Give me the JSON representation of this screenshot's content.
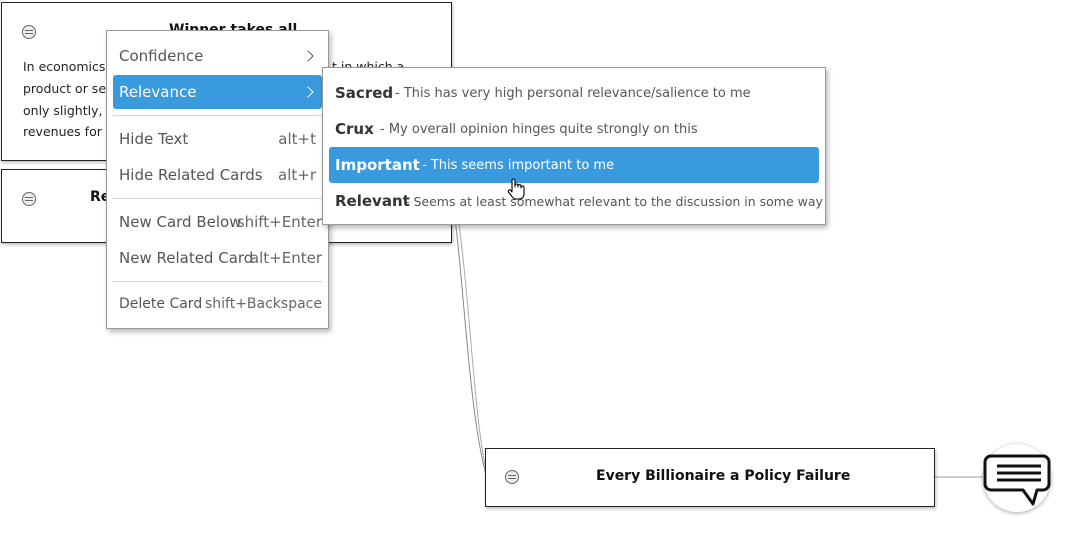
{
  "cards": {
    "top": {
      "title": "Winner takes all",
      "body_lines": [
        "In economics,",
        "product or se",
        "only slightly, r",
        "revenues for t"
      ],
      "body_right_fragment": "t in which a"
    },
    "second": {
      "title_fragment": "Re"
    },
    "bottom": {
      "title": "Every Billionaire a Policy Failure"
    }
  },
  "context_menu": {
    "items": [
      {
        "label": "Confidence",
        "shortcut": "",
        "has_submenu": true
      },
      {
        "label": "Relevance",
        "shortcut": "",
        "has_submenu": true
      },
      {
        "label": "Hide Text",
        "shortcut": "alt+t",
        "has_submenu": false
      },
      {
        "label": "Hide Related Cards",
        "shortcut": "alt+r",
        "has_submenu": false
      },
      {
        "label": "New Card Below",
        "shortcut": "shift+Enter",
        "has_submenu": false
      },
      {
        "label": "New Related Card",
        "shortcut": "alt+Enter",
        "has_submenu": false
      },
      {
        "label": "Delete Card",
        "shortcut": "shift+Backspace",
        "has_submenu": false
      }
    ],
    "active_item": "Relevance"
  },
  "relevance_submenu": {
    "items": [
      {
        "name": "Sacred",
        "desc": "- This has very high personal relevance/salience to me"
      },
      {
        "name": "Crux",
        "desc": "- My overall opinion hinges quite strongly on this"
      },
      {
        "name": "Important",
        "desc": "- This seems important to me"
      },
      {
        "name": "Relevant",
        "desc": "- Seems at least somewhat relevant to the discussion in some way"
      }
    ],
    "active_item": "Important"
  },
  "colors": {
    "accent": "#3a9ade",
    "card_border": "#222222",
    "connector": "#888888"
  },
  "icons": {
    "card_icon": "comment-circle-icon",
    "chat": "chat-bubble-icon",
    "cursor": "hand-pointer-icon"
  }
}
